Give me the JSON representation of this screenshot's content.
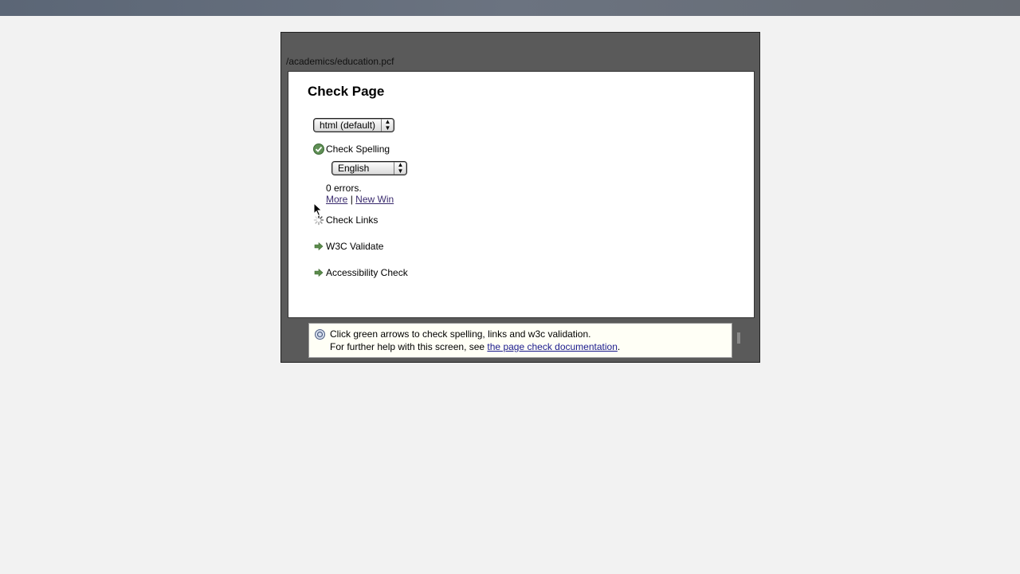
{
  "page": {
    "path": "/academics/education.pcf"
  },
  "dialog": {
    "title": "Check Page",
    "format_select": {
      "value": "html (default)"
    },
    "checks": [
      {
        "label": "Check Spelling",
        "status": "passed",
        "icon": "checkmark-icon"
      },
      {
        "label": "Check Links",
        "status": "running",
        "icon": "spinner-icon"
      },
      {
        "label": "W3C Validate",
        "status": "pending",
        "icon": "green-arrow-icon"
      },
      {
        "label": "Accessibility Check",
        "status": "pending",
        "icon": "green-arrow-icon"
      }
    ],
    "spelling": {
      "language_select": {
        "value": "English"
      },
      "result": "0 errors.",
      "more_link": "More",
      "separator": "|",
      "new_win_link": "New Win"
    }
  },
  "help": {
    "line1": "Click green arrows to check spelling, links and w3c validation.",
    "line2_prefix": "For further help with this screen, see ",
    "link_text": "the page check documentation",
    "line2_suffix": "."
  },
  "colors": {
    "modal_bg": "#5a5a5a",
    "panel_bg": "#ffffff",
    "help_bg": "#fffff6",
    "accent_green": "#5a8a4a",
    "link": "#3a2b6e"
  }
}
